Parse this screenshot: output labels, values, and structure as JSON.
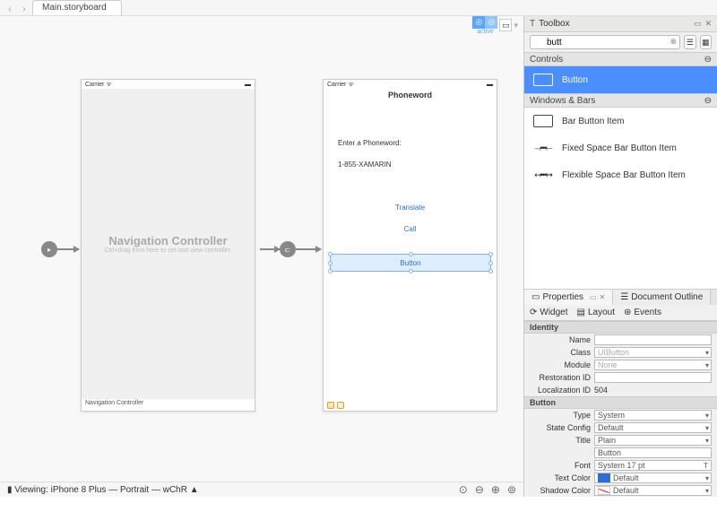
{
  "tabbar": {
    "title": "Main.storyboard"
  },
  "canvas_toolbar": {
    "active_label": "active"
  },
  "scene_nav": {
    "carrier": "Carrier",
    "wifi_icon": "wifi",
    "title": "Navigation Controller",
    "subtitle": "Ctrl+drag from here to set root view controller.",
    "footer": "Navigation Controller"
  },
  "scene_vc": {
    "carrier": "Carrier",
    "title": "Phoneword",
    "label": "Enter a Phoneword:",
    "input_value": "1-855-XAMARIN",
    "btn_translate": "Translate",
    "btn_call": "Call",
    "btn_new": "Button"
  },
  "bottombar": {
    "viewing_label": "Viewing: iPhone 8 Plus — Portrait — wChR ▲"
  },
  "toolbox": {
    "title": "Toolbox",
    "search_value": "butt",
    "section_controls": "Controls",
    "section_windows": "Windows & Bars",
    "items_controls": [
      {
        "label": "Button"
      }
    ],
    "items_windows": [
      {
        "label": "Bar Button Item"
      },
      {
        "label": "Fixed Space Bar Button Item"
      },
      {
        "label": "Flexible Space Bar Button Item"
      }
    ]
  },
  "properties": {
    "tab_properties": "Properties",
    "tab_outline": "Document Outline",
    "subtab_widget": "Widget",
    "subtab_layout": "Layout",
    "subtab_events": "Events",
    "group_identity": "Identity",
    "group_button": "Button",
    "identity": {
      "name_label": "Name",
      "name_value": "",
      "class_label": "Class",
      "class_value": "UIButton",
      "module_label": "Module",
      "module_value": "None",
      "restoration_label": "Restoration ID",
      "restoration_value": "",
      "localization_label": "Localization ID",
      "localization_value": "504"
    },
    "button": {
      "type_label": "Type",
      "type_value": "System",
      "state_label": "State Config",
      "state_value": "Default",
      "title_label": "Title",
      "title_value": "Plain",
      "title_text": "Button",
      "font_label": "Font",
      "font_value": "System 17 pt",
      "textcolor_label": "Text Color",
      "textcolor_value": "Default",
      "textcolor_swatch": "#2a6ed6",
      "shadowcolor_label": "Shadow Color",
      "shadowcolor_value": "Default",
      "shadowcolor_swatch": "#ffffff"
    }
  }
}
